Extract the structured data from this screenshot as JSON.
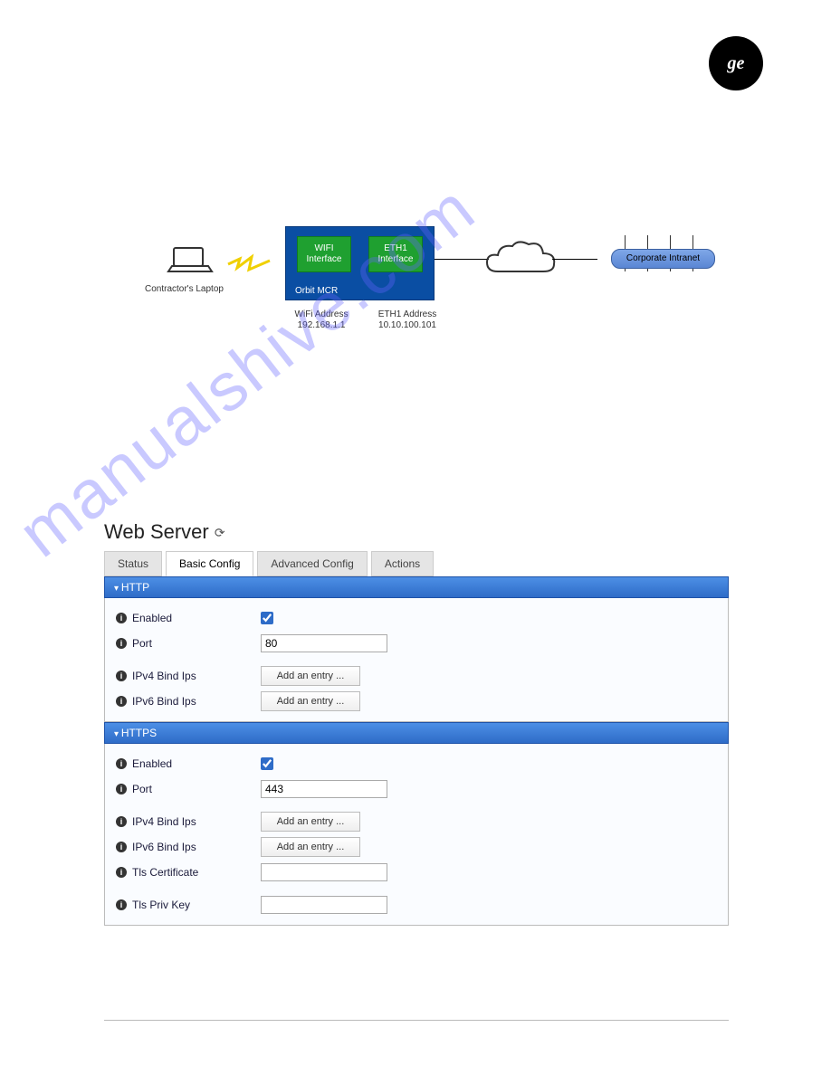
{
  "logo": {
    "text": "ge"
  },
  "diagram": {
    "laptop_label": "Contractor's Laptop",
    "wifi_if": "WIFI\nInterface",
    "eth1_if": "ETH1\nInterface",
    "orbit_label": "Orbit MCR",
    "wifi_addr_title": "WiFi Address",
    "wifi_addr_value": "192.168.1.1",
    "eth1_addr_title": "ETH1 Address",
    "eth1_addr_value": "10.10.100.101",
    "intranet": "Corporate Intranet"
  },
  "watermark": "manualshive.com",
  "panel": {
    "title": "Web Server",
    "tabs": {
      "status": "Status",
      "basic": "Basic Config",
      "advanced": "Advanced Config",
      "actions": "Actions"
    },
    "http": {
      "header": "HTTP",
      "enabled_label": "Enabled",
      "enabled_value": true,
      "port_label": "Port",
      "port_value": "80",
      "ipv4_label": "IPv4 Bind Ips",
      "ipv6_label": "IPv6 Bind Ips",
      "add_entry": "Add an entry ..."
    },
    "https": {
      "header": "HTTPS",
      "enabled_label": "Enabled",
      "enabled_value": true,
      "port_label": "Port",
      "port_value": "443",
      "ipv4_label": "IPv4 Bind Ips",
      "ipv6_label": "IPv6 Bind Ips",
      "add_entry": "Add an entry ...",
      "tls_cert_label": "Tls Certificate",
      "tls_cert_value": "",
      "tls_key_label": "Tls Priv Key",
      "tls_key_value": ""
    }
  }
}
